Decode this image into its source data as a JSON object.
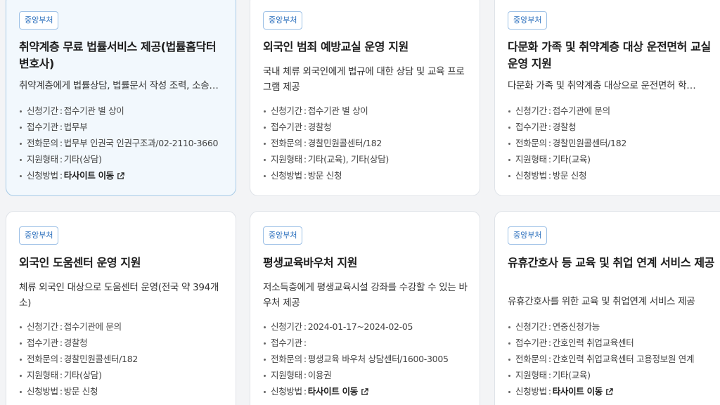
{
  "labels": {
    "period": "신청기간",
    "agency": "접수기관",
    "phone": "전화문의",
    "type": "지원형태",
    "method": "신청방법"
  },
  "separator": ":",
  "cards": [
    {
      "badge": "중앙부처",
      "title": "취약계층 무료 법률서비스 제공(법률홈닥터 변호사)",
      "desc": "취약계층에게 법률상담, 법률문서 작성 조력, 소송구조 안내 등",
      "period": "접수기관 별 상이",
      "agency": "법무부",
      "phone": "법무부 인권국 인권구조과/02-2110-3660",
      "type": "기타(상담)",
      "method": "타사이트 이동"
    },
    {
      "badge": "중앙부처",
      "title": "외국인 범죄 예방교실 운영 지원",
      "desc": "국내 체류 외국인에게 법규에 대한 상담 및 교육 프로그램 제공",
      "period": "접수기관 별 상이",
      "agency": "경찰청",
      "phone": "경찰민원콜센터/182",
      "type": "기타(교육), 기타(상담)",
      "method": "방문 신청"
    },
    {
      "badge": "중앙부처",
      "title": "다문화 가족 및 취약계층 대상 운전면허 교실 운영 지원",
      "desc": "다문화 가족 및 취약계층 대상으로 운전면허 학과시험 교육 지원",
      "period": "접수기관에 문의",
      "agency": "경찰청",
      "phone": "경찰민원콜센터/182",
      "type": "기타(교육)",
      "method": "방문 신청"
    },
    {
      "badge": "중앙부처",
      "title": "외국인 도움센터 운영 지원",
      "desc": "체류 외국인 대상으로 도움센터 운영(전국 약 394개소)",
      "period": "접수기관에 문의",
      "agency": "경찰청",
      "phone": "경찰민원콜센터/182",
      "type": "기타(상담)",
      "method": "방문 신청"
    },
    {
      "badge": "중앙부처",
      "title": "평생교육바우처 지원",
      "desc": "저소득층에게 평생교육시설 강좌를 수강할 수 있는 바우처 제공",
      "period": "2024-01-17~2024-02-05",
      "agency": "",
      "phone": "평생교육 바우처 상담센터/1600-3005",
      "type": "이용권",
      "method": "타사이트 이동"
    },
    {
      "badge": "중앙부처",
      "title": "유휴간호사 등 교육 및 취업 연계 서비스 제공",
      "desc": "유휴간호사를 위한 교육 및 취업연계 서비스 제공",
      "period": "연중신청가능",
      "agency": "간호인력 취업교육센터",
      "phone": "간호인력 취업교육센터 고용정보원 연계",
      "type": "기타(교육)",
      "method": "타사이트 이동"
    }
  ]
}
